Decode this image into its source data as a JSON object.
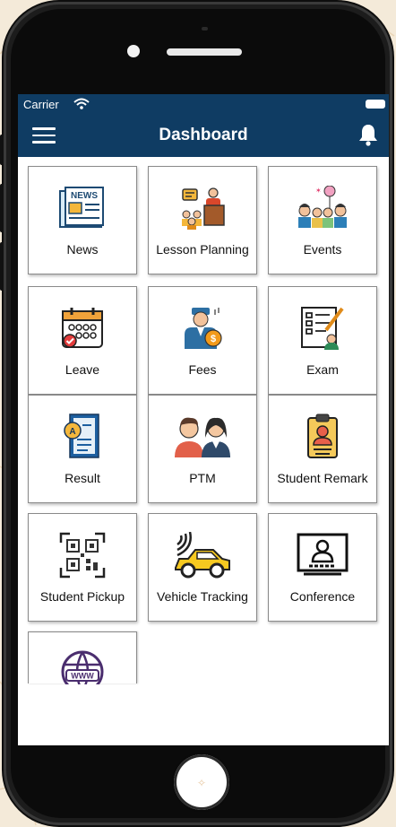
{
  "status_bar": {
    "carrier": "Carrier"
  },
  "header": {
    "title": "Dashboard"
  },
  "tiles": [
    {
      "label": "News",
      "icon": "newspaper-icon"
    },
    {
      "label": "Lesson Planning",
      "icon": "teacher-lectern-icon"
    },
    {
      "label": "Events",
      "icon": "party-people-icon"
    },
    {
      "label": "Leave",
      "icon": "calendar-icon"
    },
    {
      "label": "Fees",
      "icon": "fee-payer-icon"
    },
    {
      "label": "Exam",
      "icon": "exam-sheet-icon"
    },
    {
      "label": "Result",
      "icon": "result-document-icon"
    },
    {
      "label": "PTM",
      "icon": "parents-icon"
    },
    {
      "label": "Student Remark",
      "icon": "id-badge-icon"
    },
    {
      "label": "Student Pickup",
      "icon": "qr-code-icon"
    },
    {
      "label": "Vehicle Tracking",
      "icon": "car-signal-icon"
    },
    {
      "label": "Conference",
      "icon": "video-conference-icon"
    },
    {
      "label": "",
      "icon": "www-globe-icon"
    }
  ],
  "colors": {
    "header_bg": "#0f3c63",
    "tile_border": "#8a8a8a"
  }
}
